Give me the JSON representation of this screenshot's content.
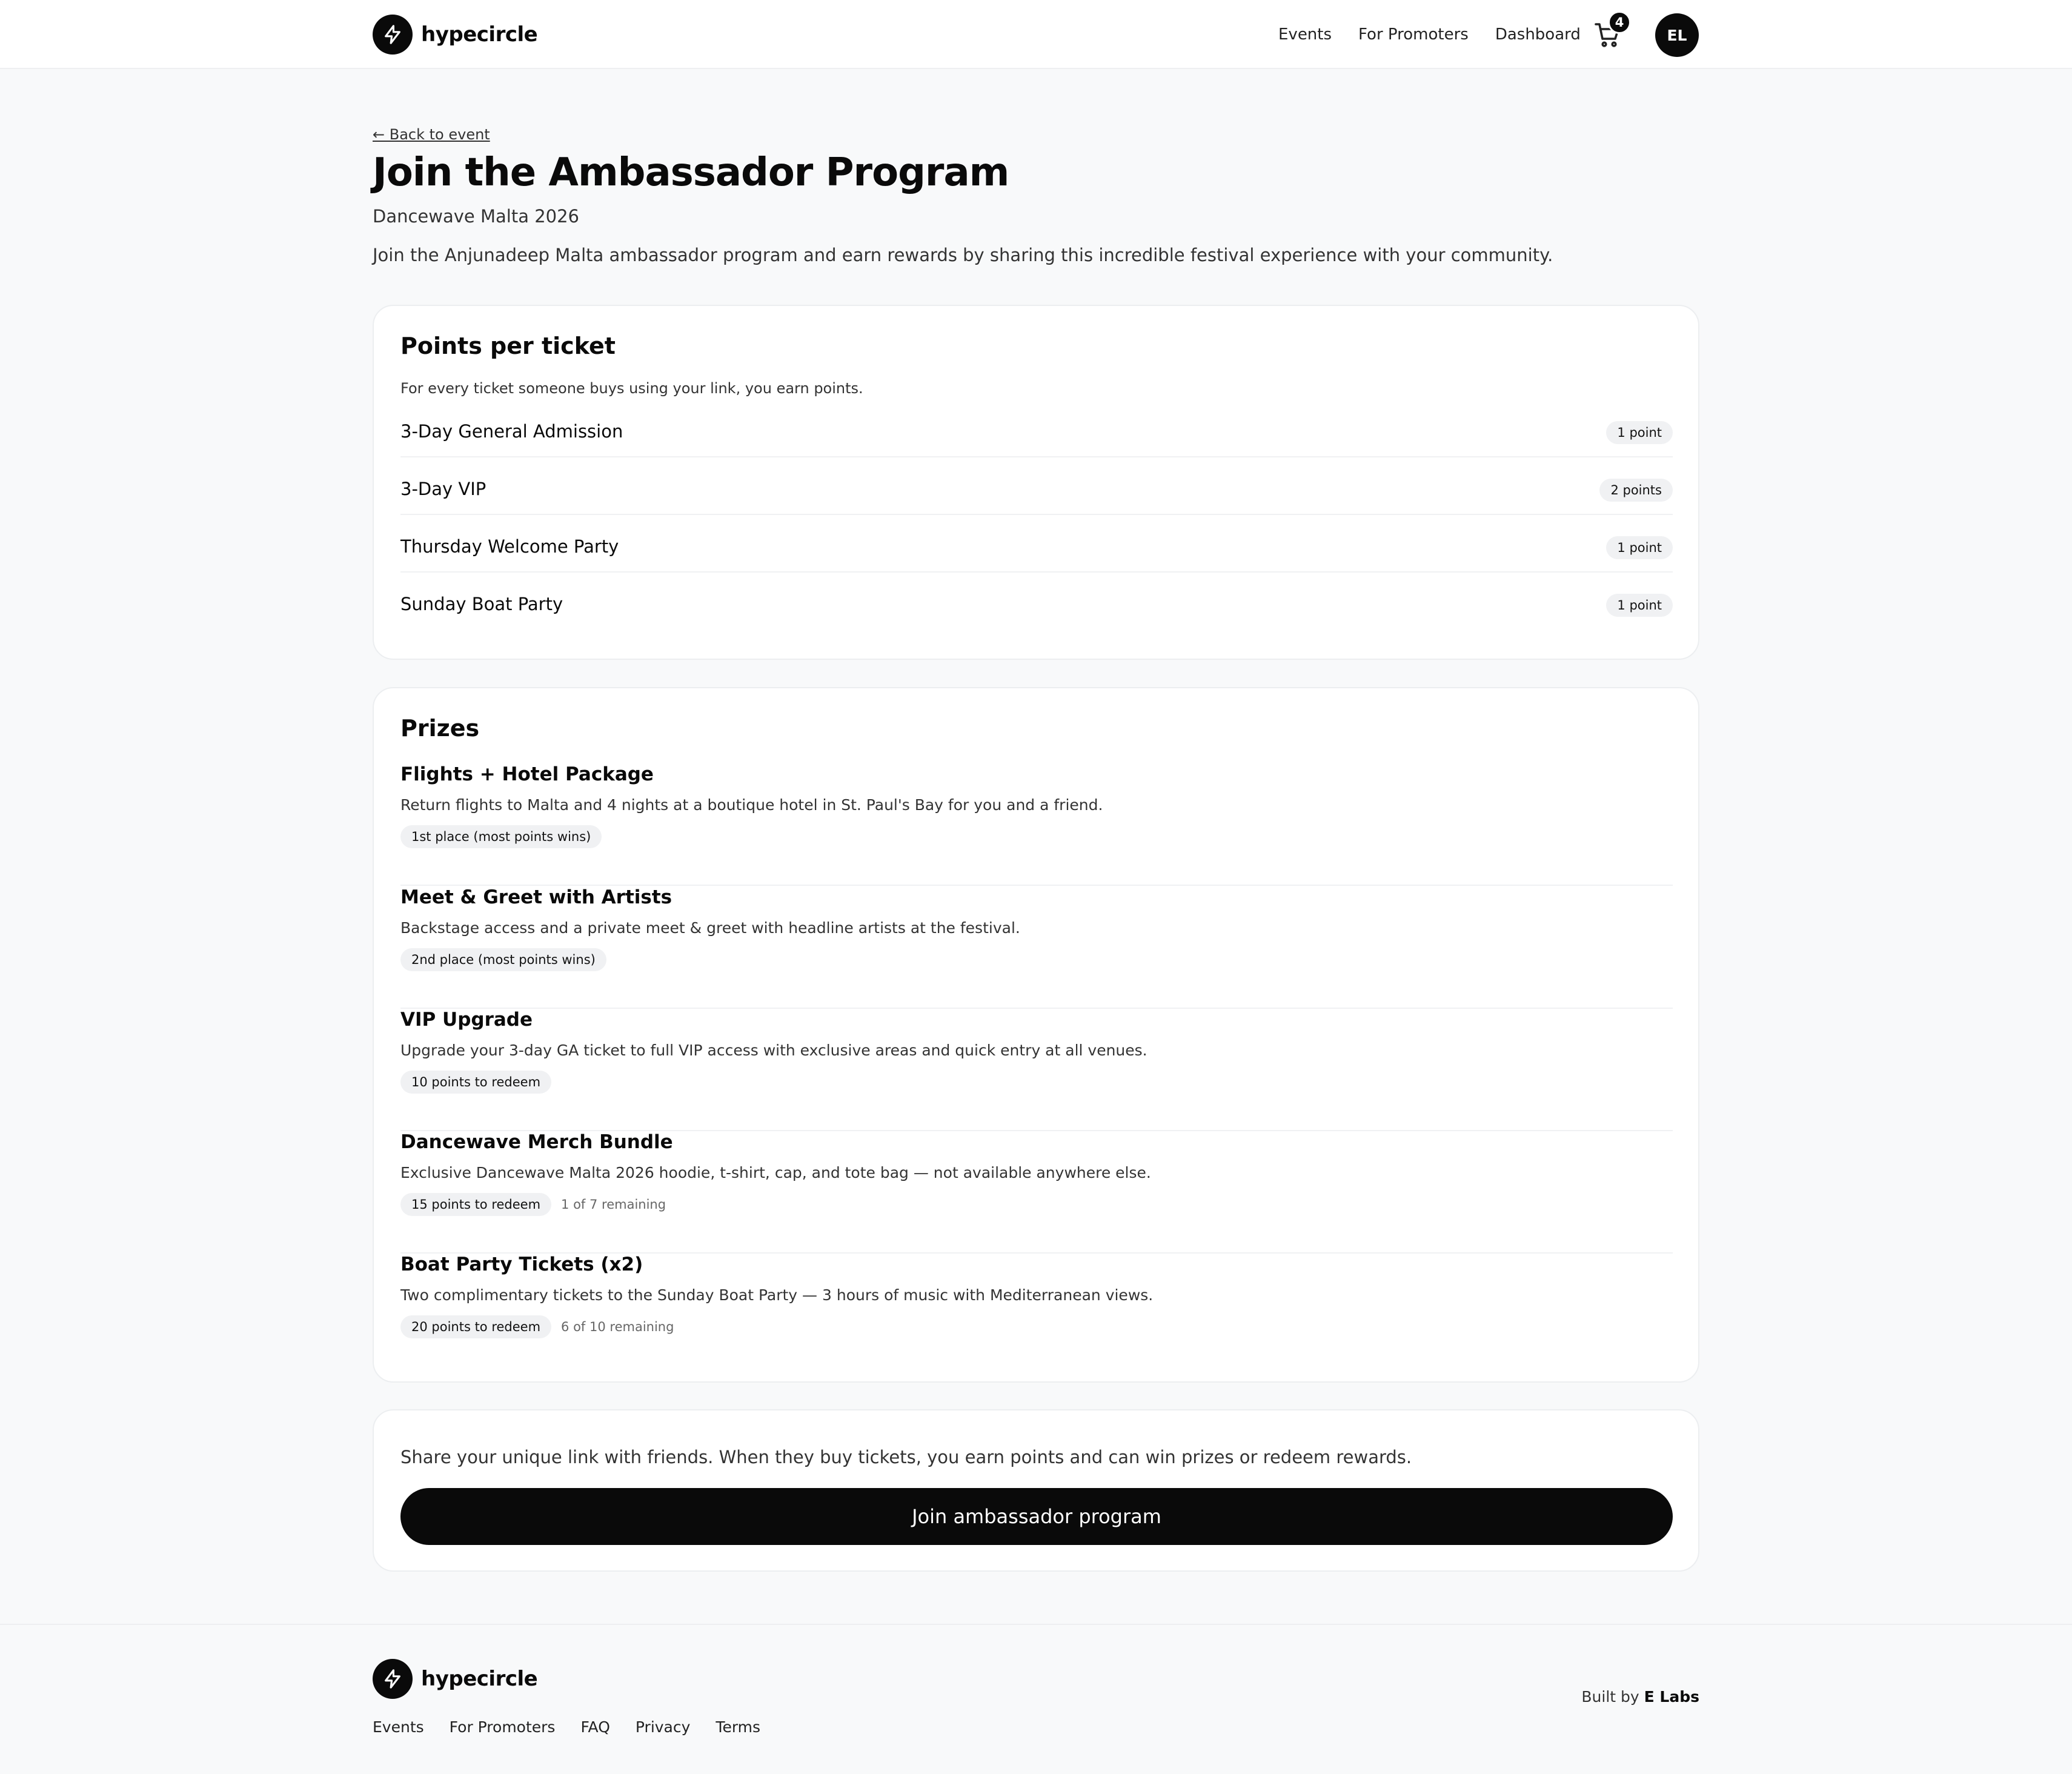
{
  "header": {
    "brand": "hypecircle",
    "nav": [
      "Events",
      "For Promoters",
      "Dashboard"
    ],
    "cart_count": "4",
    "avatar_initials": "EL"
  },
  "page": {
    "back_link": "← Back to event",
    "title": "Join the Ambassador Program",
    "event_name": "Dancewave Malta 2026",
    "intro": "Join the Anjunadeep Malta ambassador program and earn rewards by sharing this incredible festival experience with your community."
  },
  "points": {
    "title": "Points per ticket",
    "description": "For every ticket someone buys using your link, you earn points.",
    "tiers": [
      {
        "name": "3-Day General Admission",
        "points": "1 point"
      },
      {
        "name": "3-Day VIP",
        "points": "2 points"
      },
      {
        "name": "Thursday Welcome Party",
        "points": "1 point"
      },
      {
        "name": "Sunday Boat Party",
        "points": "1 point"
      }
    ]
  },
  "prizes": {
    "title": "Prizes",
    "items": [
      {
        "name": "Flights + Hotel Package",
        "description": "Return flights to Malta and 4 nights at a boutique hotel in St. Paul's Bay for you and a friend.",
        "badge": "1st place (most points wins)",
        "remaining": ""
      },
      {
        "name": "Meet & Greet with Artists",
        "description": "Backstage access and a private meet & greet with headline artists at the festival.",
        "badge": "2nd place (most points wins)",
        "remaining": ""
      },
      {
        "name": "VIP Upgrade",
        "description": "Upgrade your 3-day GA ticket to full VIP access with exclusive areas and quick entry at all venues.",
        "badge": "10 points to redeem",
        "remaining": ""
      },
      {
        "name": "Dancewave Merch Bundle",
        "description": "Exclusive Dancewave Malta 2026 hoodie, t-shirt, cap, and tote bag — not available anywhere else.",
        "badge": "15 points to redeem",
        "remaining": "1 of 7 remaining"
      },
      {
        "name": "Boat Party Tickets (x2)",
        "description": "Two complimentary tickets to the Sunday Boat Party — 3 hours of music with Mediterranean views.",
        "badge": "20 points to redeem",
        "remaining": "6 of 10 remaining"
      }
    ]
  },
  "cta": {
    "text": "Share your unique link with friends. When they buy tickets, you earn points and can win prizes or redeem rewards.",
    "button": "Join ambassador program"
  },
  "footer": {
    "brand": "hypecircle",
    "links": [
      "Events",
      "For Promoters",
      "FAQ",
      "Privacy",
      "Terms"
    ],
    "built_by_prefix": "Built by",
    "built_by_name": "E Labs"
  }
}
